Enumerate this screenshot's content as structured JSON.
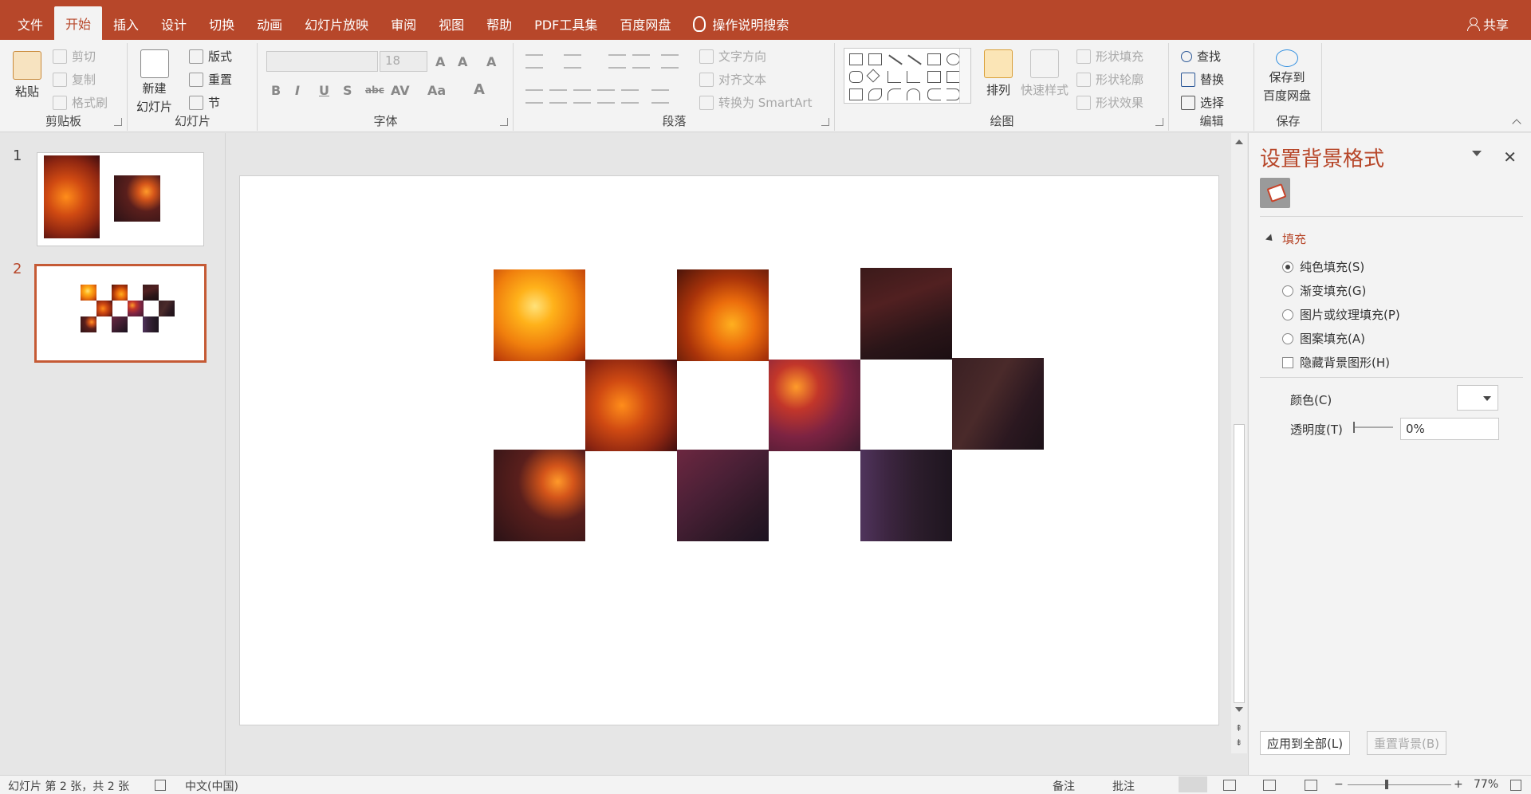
{
  "menubar": {
    "items": [
      "文件",
      "开始",
      "插入",
      "设计",
      "切换",
      "动画",
      "幻灯片放映",
      "审阅",
      "视图",
      "帮助",
      "PDF工具集",
      "百度网盘"
    ],
    "active_index": 1,
    "search_label": "操作说明搜索",
    "share_label": "共享"
  },
  "ribbon": {
    "clipboard": {
      "paste": "粘贴",
      "cut": "剪切",
      "copy": "复制",
      "format_painter": "格式刷",
      "label": "剪贴板"
    },
    "slides": {
      "new_slide_1": "新建",
      "new_slide_2": "幻灯片",
      "layout": "版式",
      "reset": "重置",
      "section": "节",
      "label": "幻灯片"
    },
    "font": {
      "font_name": "",
      "font_size": "18",
      "label": "字体"
    },
    "paragraph": {
      "text_direction": "文字方向",
      "align_text": "对齐文本",
      "convert_smartart": "转换为 SmartArt",
      "label": "段落"
    },
    "drawing": {
      "arrange": "排列",
      "quick_styles": "快速样式",
      "shape_fill": "形状填充",
      "shape_outline": "形状轮廓",
      "shape_effects": "形状效果",
      "label": "绘图"
    },
    "editing": {
      "find": "查找",
      "replace": "替换",
      "select": "选择",
      "label": "编辑"
    },
    "save": {
      "save_1": "保存到",
      "save_2": "百度网盘",
      "label": "保存"
    }
  },
  "thumbnails": {
    "slide1_num": "1",
    "slide2_num": "2",
    "selected": 2
  },
  "format_pane": {
    "title": "设置背景格式",
    "section": "填充",
    "options": [
      "纯色填充(S)",
      "渐变填充(G)",
      "图片或纹理填充(P)",
      "图案填充(A)"
    ],
    "selected_option": 0,
    "hide_bg_graphics": "隐藏背景图形(H)",
    "color_label": "颜色(C)",
    "transparency_label": "透明度(T)",
    "transparency_value": "0%",
    "apply_all": "应用到全部(L)",
    "reset_bg": "重置背景(B)"
  },
  "statusbar": {
    "slide_info": "幻灯片 第 2 张，共 2 张",
    "language": "中文(中国)",
    "notes": "备注",
    "comments": "批注",
    "zoom": "77%"
  },
  "colors": {
    "accent": "#b7472a"
  }
}
